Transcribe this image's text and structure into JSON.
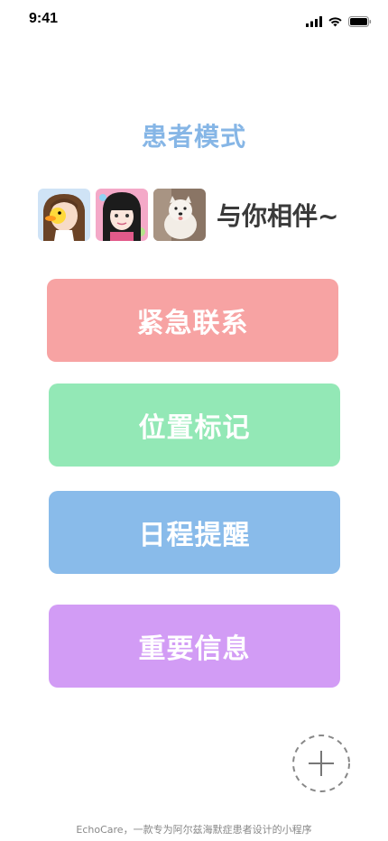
{
  "status_bar": {
    "time": "9:41",
    "icons": [
      "signal-icon",
      "wifi-icon",
      "battery-icon"
    ]
  },
  "title": "患者模式",
  "companion": {
    "text": "与你相伴~",
    "avatars": [
      "avatar-girl-duck",
      "avatar-girl-dark-hair",
      "avatar-white-dog"
    ]
  },
  "actions": {
    "emergency": "紧急联系",
    "location": "位置标记",
    "schedule": "日程提醒",
    "info": "重要信息"
  },
  "add_button": {
    "icon": "plus-icon"
  },
  "footer": "EchoCare，一款专为阿尔兹海默症患者设计的小程序",
  "colors": {
    "title": "#86b6e6",
    "emergency": "#f7a3a3",
    "location": "#93e8b6",
    "schedule": "#89bbea",
    "info": "#d29cf5"
  }
}
